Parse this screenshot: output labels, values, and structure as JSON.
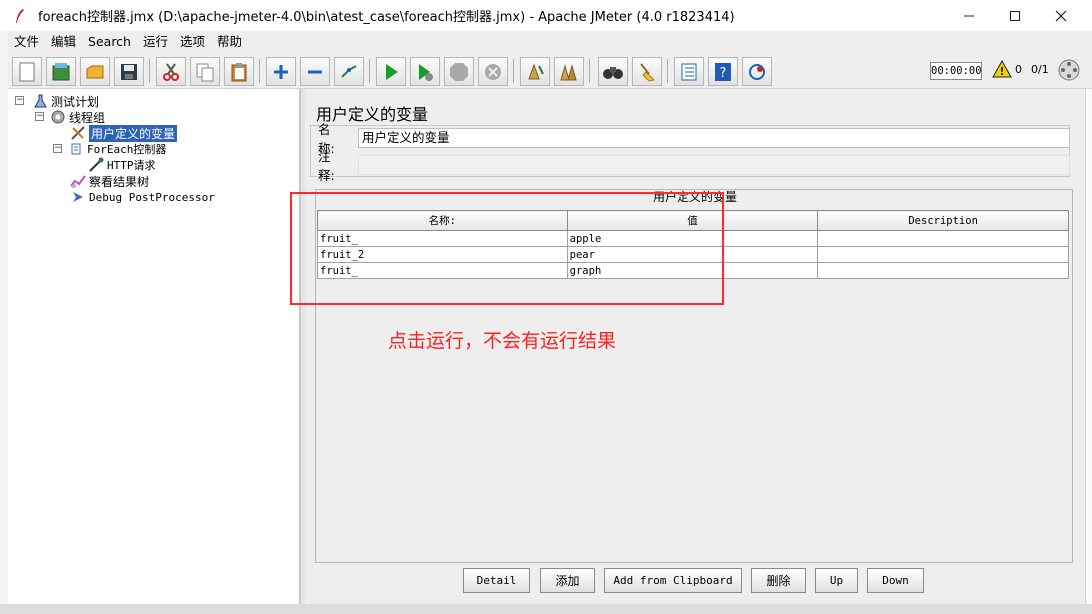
{
  "window": {
    "title": "foreach控制器.jmx (D:\\apache-jmeter-4.0\\bin\\atest_case\\foreach控制器.jmx) - Apache JMeter (4.0 r1823414)",
    "minimize_icon": "minimize-icon",
    "maximize_icon": "maximize-icon",
    "close_icon": "close-icon"
  },
  "menu": [
    "文件",
    "编辑",
    "Search",
    "运行",
    "选项",
    "帮助"
  ],
  "toolbar": {
    "icons": [
      "new-icon",
      "templates-icon",
      "open-icon",
      "save-icon",
      "cut-icon",
      "copy-icon",
      "paste-icon",
      "expand-icon",
      "collapse-icon",
      "toggle-icon",
      "start-icon",
      "start-no-pause-icon",
      "stop-icon",
      "shutdown-icon",
      "clear-icon",
      "clear-all-icon",
      "search-icon",
      "reset-search-icon",
      "function-helper-icon",
      "help-icon",
      "remote-icon"
    ],
    "timer": "00:00:00",
    "warning_count": "0",
    "thread_count": "0/1"
  },
  "tree": {
    "nodes": [
      {
        "label": "测试计划"
      },
      {
        "label": "线程组"
      },
      {
        "label": "用户定义的变量"
      },
      {
        "label": "ForEach控制器"
      },
      {
        "label": "HTTP请求"
      },
      {
        "label": "察看结果树"
      },
      {
        "label": "Debug PostProcessor"
      }
    ]
  },
  "editor": {
    "title": "用户定义的变量",
    "name_label": "名称:",
    "name_value": "用户定义的变量",
    "comment_label": "注释:",
    "comment_value": "",
    "table_caption": "用户定义的变量",
    "columns": [
      "名称:",
      "值",
      "Description"
    ],
    "rows": [
      {
        "name": "fruit_",
        "value": "apple",
        "description": ""
      },
      {
        "name": "fruit_2",
        "value": "pear",
        "description": ""
      },
      {
        "name": "fruit_",
        "value": "graph",
        "description": ""
      }
    ],
    "buttons": [
      "Detail",
      "添加",
      "Add from Clipboard",
      "删除",
      "Up",
      "Down"
    ]
  },
  "annotation": {
    "text": "点击运行，不会有运行结果",
    "color": "#ff2020"
  }
}
